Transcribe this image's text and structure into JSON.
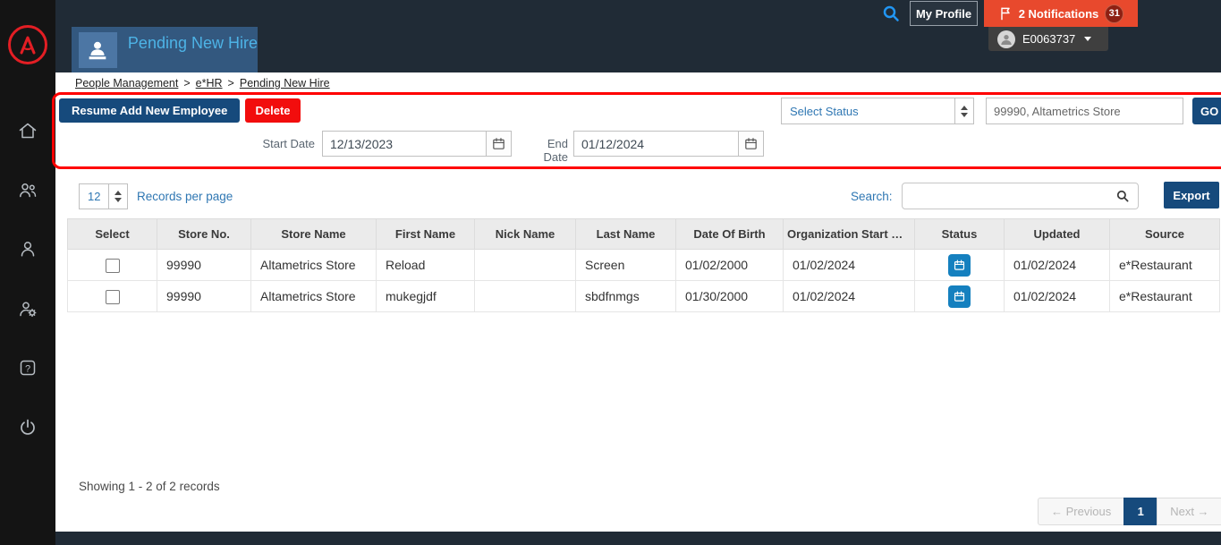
{
  "colors": {
    "topbar_bg": "#202b36",
    "sidebar_bg": "#141414",
    "title_block_bg": "#33587f",
    "title_text": "#4db3e6",
    "primary_button": "#164a7c",
    "danger_button": "#f20d0d",
    "notification_bg": "#e8492d",
    "link_blue": "#2f77b3",
    "status_icon_blue": "#1580bf",
    "annotation_red": "#ff0000",
    "logo_red": "#e31e24"
  },
  "topbar": {
    "my_profile": "My Profile",
    "notifications": {
      "label": "2 Notifications",
      "count": "31"
    },
    "user_id": "E0063737"
  },
  "header": {
    "title": "Pending New Hire",
    "breadcrumb": [
      "People Management",
      "e*HR",
      "Pending New Hire"
    ],
    "breadcrumb_sep": ">"
  },
  "toolbar": {
    "resume": "Resume Add New Employee",
    "delete": "Delete",
    "start_date": {
      "label": "Start Date",
      "value": "12/13/2023"
    },
    "end_date": {
      "label": "End Date",
      "value": "01/12/2024"
    },
    "status_select": {
      "value": "Select Status"
    },
    "store_filter": {
      "value": "99990, Altametrics Store"
    },
    "go": "GO"
  },
  "listbar": {
    "per_page": {
      "value": "12",
      "label": "Records per page"
    },
    "search_label": "Search:",
    "export": "Export"
  },
  "table": {
    "columns": [
      "Select",
      "Store No.",
      "Store Name",
      "First Name",
      "Nick Name",
      "Last Name",
      "Date Of Birth",
      "Organization Start D…",
      "Status",
      "Updated",
      "Source"
    ],
    "rows": [
      {
        "store_no": "99990",
        "store_name": "Altametrics Store",
        "first_name": "Reload",
        "nick_name": "",
        "last_name": "Screen",
        "dob": "01/02/2000",
        "org_start": "01/02/2024",
        "updated": "01/02/2024",
        "source": "e*Restaurant"
      },
      {
        "store_no": "99990",
        "store_name": "Altametrics Store",
        "first_name": "mukegjdf",
        "nick_name": "",
        "last_name": "sbdfnmgs",
        "dob": "01/30/2000",
        "org_start": "01/02/2024",
        "updated": "01/02/2024",
        "source": "e*Restaurant"
      }
    ]
  },
  "footer": {
    "showing": "Showing 1 - 2 of 2 records",
    "prev": "← Previous",
    "page": "1",
    "next": "Next →"
  }
}
